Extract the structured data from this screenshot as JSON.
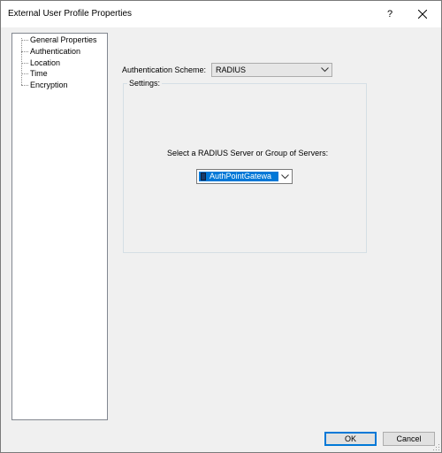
{
  "window": {
    "title": "External User Profile Properties",
    "help_label": "?"
  },
  "tree": {
    "items": [
      {
        "label": "General Properties"
      },
      {
        "label": "Authentication"
      },
      {
        "label": "Location"
      },
      {
        "label": "Time"
      },
      {
        "label": "Encryption"
      }
    ]
  },
  "authentication": {
    "scheme_label": "Authentication Scheme:",
    "scheme_value": "RADIUS",
    "settings_legend": "Settings:",
    "server_label": "Select a RADIUS Server or Group of Servers:",
    "server_value": "AuthPointGatewa"
  },
  "buttons": {
    "ok": "OK",
    "cancel": "Cancel"
  },
  "icons": {
    "close": "close-icon",
    "dropdown": "chevron-down-icon",
    "server": "server-icon",
    "grip": "resize-grip-icon"
  },
  "colors": {
    "selection": "#0078d7",
    "default_button_border": "#0078d7"
  }
}
